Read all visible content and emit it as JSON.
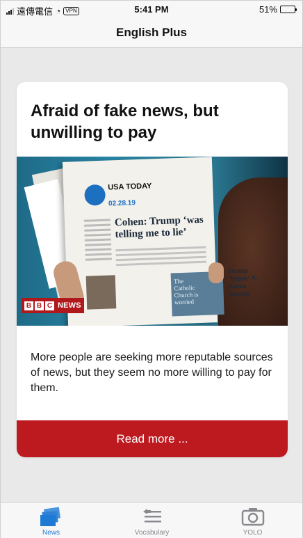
{
  "status_bar": {
    "carrier": "遠傳電信",
    "vpn": "VPN",
    "time": "5:41 PM",
    "battery_percent": "51%",
    "battery_level": 0.51
  },
  "nav": {
    "title": "English Plus"
  },
  "article": {
    "title": "Afraid of fake news, but unwilling to pay",
    "summary": "More people are seeking more reputable sources of news, but they seem no more willing to pay for them.",
    "read_more_label": "Read more ...",
    "image": {
      "paper_name": "USA TODAY",
      "paper_date": "02.28.19",
      "headline": "Cohen: Trump ‘was telling me to lie’",
      "inset_text": "The Catholic Church is worried",
      "side_text": "Trump ‘hypes’ N. Korea success",
      "badge_letters": [
        "B",
        "B",
        "C"
      ],
      "badge_news": "NEWS"
    }
  },
  "tabs": [
    {
      "label": "News",
      "icon": "news-icon",
      "active": true
    },
    {
      "label": "Vocabulary",
      "icon": "vocabulary-list-icon",
      "active": false
    },
    {
      "label": "YOLO",
      "icon": "camera-icon",
      "active": false
    }
  ],
  "colors": {
    "accent": "#1f7ad4",
    "read_more_bg": "#bd1a1f",
    "bbc_red": "#b0181c",
    "background": "#e9e9ea"
  }
}
